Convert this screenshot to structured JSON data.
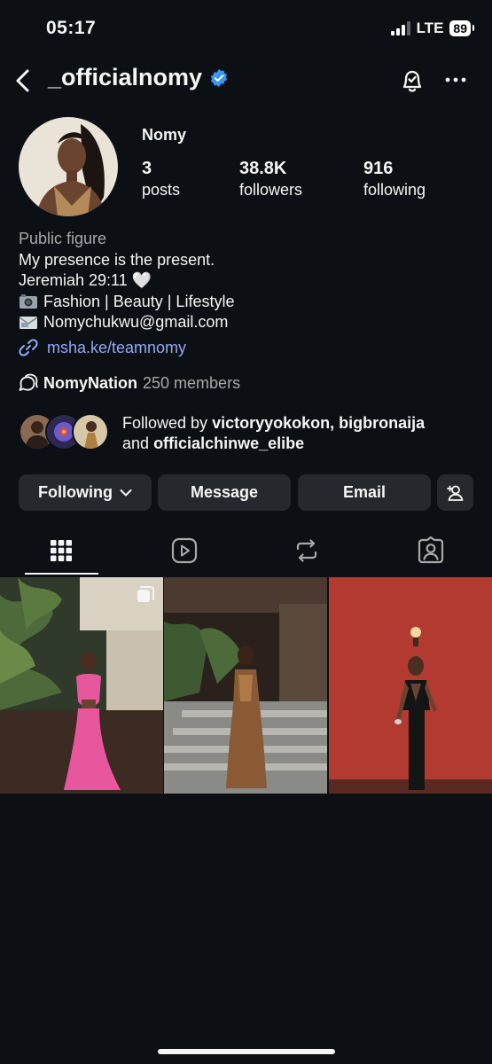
{
  "status_bar": {
    "time": "05:17",
    "network": "LTE",
    "battery": "89"
  },
  "header": {
    "username": "_officialnomy",
    "icons": [
      "back-arrow-icon",
      "verified-badge-icon",
      "notification-bell-icon",
      "more-options-icon"
    ]
  },
  "profile": {
    "display_name": "Nomy",
    "stats": {
      "posts_count": "3",
      "posts_label": "posts",
      "followers_count": "38.8K",
      "followers_label": "followers",
      "following_count": "916",
      "following_label": "following"
    },
    "bio": {
      "category": "Public figure",
      "line1": "My presence is the present.",
      "line2": "Jeremiah 29:11 🤍",
      "line3": "Fashion | Beauty | Lifestyle",
      "line4": "Nomychukwu@gmail.com"
    },
    "link": "msha.ke/teamnomy",
    "channel": {
      "name": "NomyNation",
      "members": "250 members"
    },
    "followed_by": {
      "prefix": "Followed by",
      "users_line1": "victoryyokokon, bigbronaija",
      "conj": "and",
      "users_line2": "officialchinwe_elibe"
    }
  },
  "actions": {
    "following_label": "Following",
    "message_label": "Message",
    "email_label": "Email"
  },
  "tabs": [
    "grid-tab",
    "reels-tab",
    "reposts-tab",
    "tagged-tab"
  ],
  "colors": {
    "background": "#0c1014",
    "button": "#25292e",
    "link": "#94a8f5",
    "verified": "#3897f0"
  }
}
